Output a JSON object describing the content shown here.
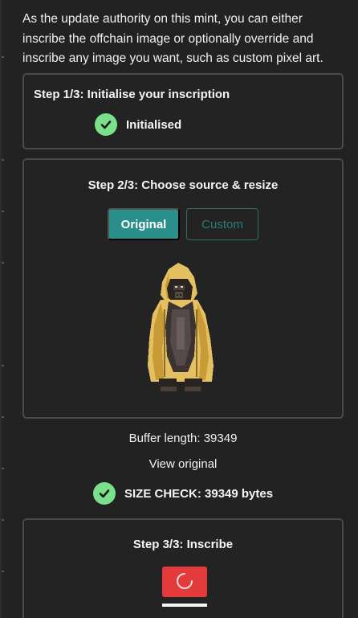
{
  "intro": {
    "text": "As the update authority on this mint, you can either inscribe the offchain image or optionally override and inscribe any image you want, such as custom pixel art."
  },
  "step1": {
    "title": "Step 1/3: Initialise your inscription",
    "status": "Initialised",
    "status_icon": "check-circle-icon",
    "status_color": "#7be08a"
  },
  "step2": {
    "title": "Step 2/3: Choose source & resize",
    "buttons": {
      "original": "Original",
      "custom": "Custom"
    },
    "selected": "Original",
    "preview_image": "hooded-ape-pixel-art"
  },
  "buffer": {
    "length_text": "Buffer length: 39349",
    "view_link": "View original"
  },
  "size_check": {
    "text": "SIZE CHECK: 39349 bytes",
    "status_icon": "check-circle-icon"
  },
  "step3": {
    "title": "Step 3/3: Inscribe",
    "button_icon": "loading-spinner-icon"
  },
  "colors": {
    "accent": "#2a8f8a",
    "success": "#7be08a",
    "danger": "#e33b3b",
    "background": "#222222"
  }
}
